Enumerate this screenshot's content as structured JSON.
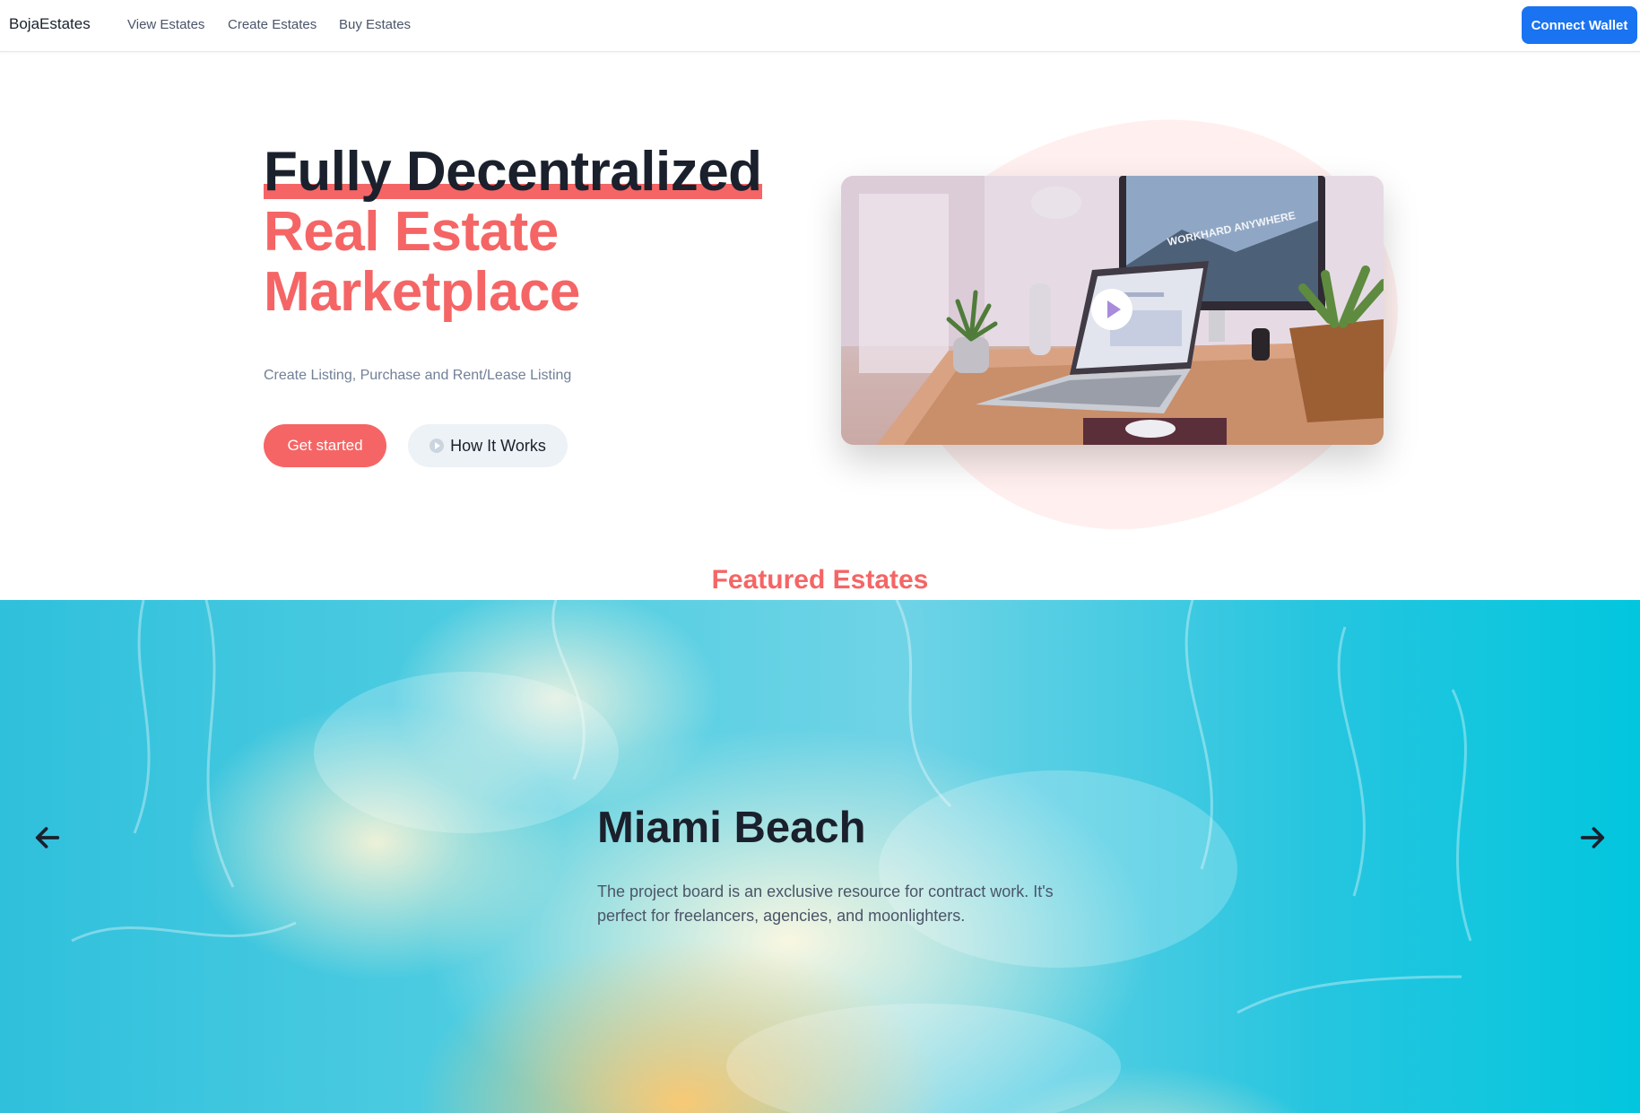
{
  "navbar": {
    "brand": "BojaEstates",
    "links": [
      "View Estates",
      "Create Estates",
      "Buy Estates"
    ],
    "connect_label": "Connect Wallet"
  },
  "hero": {
    "title_line1": "Fully Decentralized",
    "title_line2": "Real Estate",
    "title_line3": "Marketplace",
    "subtitle": "Create Listing, Purchase and Rent/Lease Listing",
    "primary_button": "Get started",
    "secondary_button": "How It Works",
    "image_overlay_text": "WORKHARD ANYWHERE"
  },
  "featured": {
    "section_title": "Featured Estates",
    "current": {
      "name": "Miami Beach",
      "description": "The project board is an exclusive resource for contract work. It's perfect for freelancers, agencies, and moonlighters."
    }
  },
  "icons": {
    "play": "play-icon",
    "prev": "arrow-left-icon",
    "next": "arrow-right-icon"
  },
  "colors": {
    "accent": "#f56565",
    "primary_blue": "#1a73f0",
    "text_dark": "#1a202c",
    "text_muted": "#718096"
  }
}
